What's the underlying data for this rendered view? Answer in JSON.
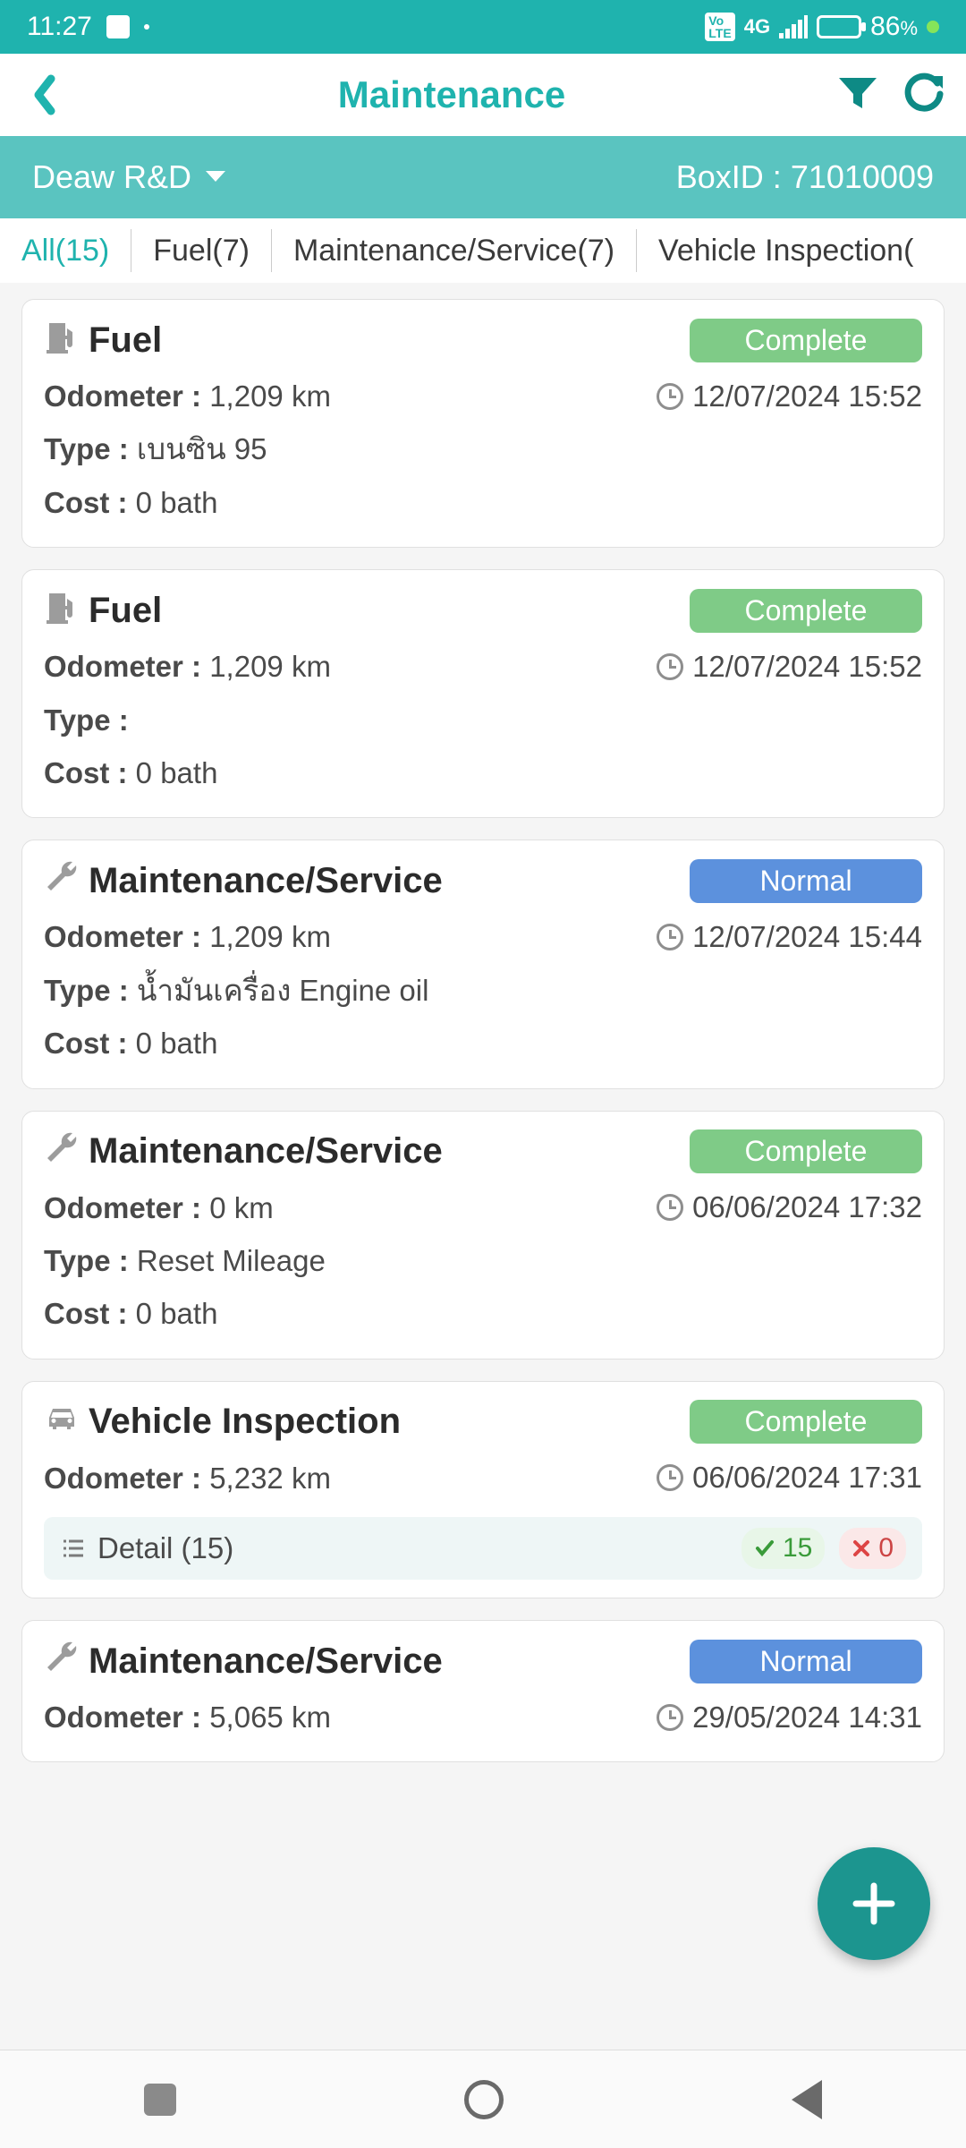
{
  "status": {
    "time": "11:27",
    "battery": "86",
    "pct": "%"
  },
  "appbar": {
    "title": "Maintenance"
  },
  "subbar": {
    "vehicle": "Deaw R&D",
    "boxid_label": "BoxID :",
    "boxid": "71010009"
  },
  "tabs": {
    "all": "All(15)",
    "fuel": "Fuel(7)",
    "maint": "Maintenance/Service(7)",
    "insp": "Vehicle Inspection("
  },
  "labels": {
    "odometer": "Odometer :",
    "type": "Type :",
    "cost": "Cost :",
    "detail": "Detail"
  },
  "cards": [
    {
      "title": "Fuel",
      "icon": "fuel",
      "badge": "Complete",
      "badgeCls": "complete",
      "odo": "1,209 km",
      "date": "12/07/2024 15:52",
      "type": "เบนซิน 95",
      "cost": "0 bath"
    },
    {
      "title": "Fuel",
      "icon": "fuel",
      "badge": "Complete",
      "badgeCls": "complete",
      "odo": "1,209 km",
      "date": "12/07/2024 15:52",
      "type": "",
      "cost": "0 bath"
    },
    {
      "title": "Maintenance/Service",
      "icon": "wrench",
      "badge": "Normal",
      "badgeCls": "normal",
      "odo": "1,209 km",
      "date": "12/07/2024 15:44",
      "type": "น้ำมันเครื่อง Engine oil",
      "cost": "0 bath"
    },
    {
      "title": "Maintenance/Service",
      "icon": "wrench",
      "badge": "Complete",
      "badgeCls": "complete",
      "odo": "0 km",
      "date": "06/06/2024 17:32",
      "type": "Reset Mileage",
      "cost": "0 bath"
    },
    {
      "title": "Vehicle Inspection",
      "icon": "car",
      "badge": "Complete",
      "badgeCls": "complete",
      "odo": "5,232 km",
      "date": "06/06/2024 17:31",
      "detail_count": "(15)",
      "ok": "15",
      "bad": "0"
    },
    {
      "title": "Maintenance/Service",
      "icon": "wrench",
      "badge": "Normal",
      "badgeCls": "normal",
      "odo": "5,065 km",
      "date": "29/05/2024 14:31"
    }
  ]
}
